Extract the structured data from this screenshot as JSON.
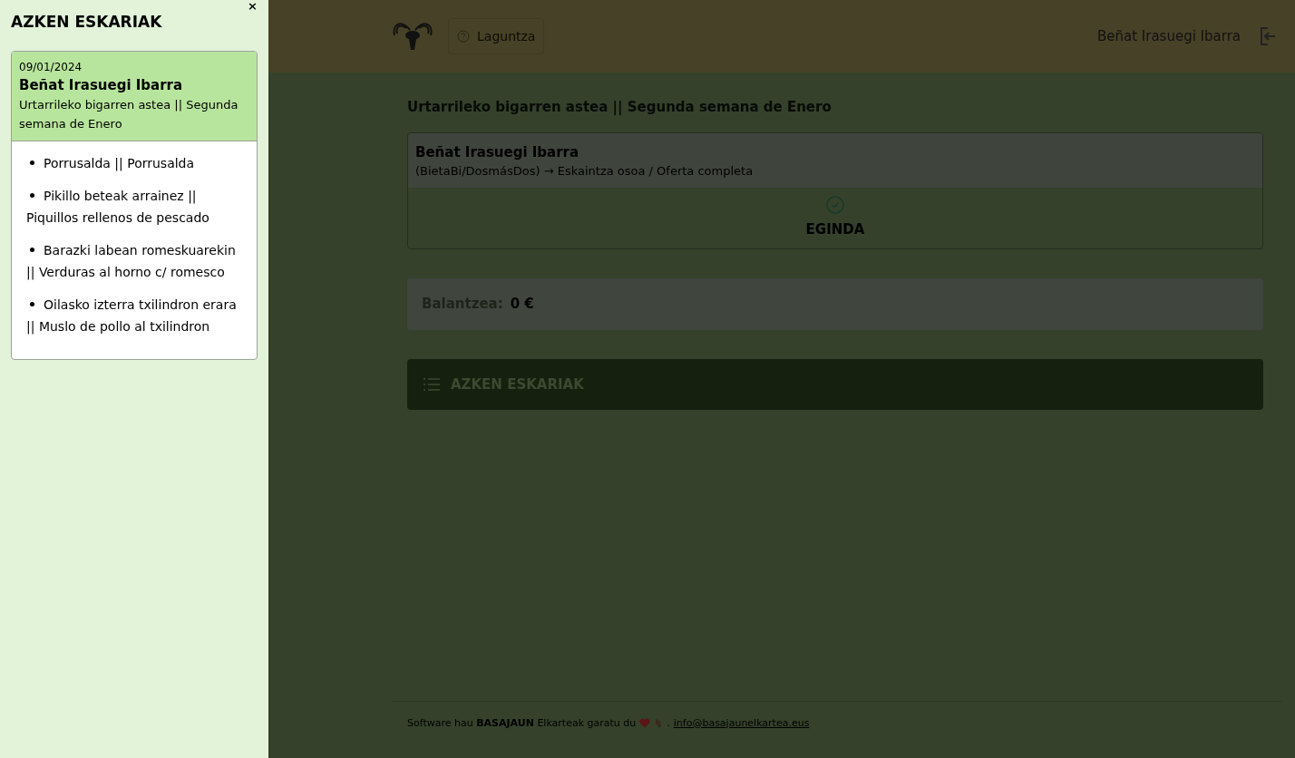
{
  "drawer": {
    "title": "AZKEN ESKARIAK",
    "close": "×",
    "orders": [
      {
        "date": "09/01/2024",
        "name": "Beñat Irasuegi Ibarra",
        "week": "Urtarrileko bigarren astea || Segunda semana de Enero",
        "items": [
          "Porrusalda || Porrusalda",
          "Pikillo beteak arrainez || Piquillos rellenos de pescado",
          "Barazki labean romeskuarekin || Verduras al horno c/ romesco",
          "Oilasko izterra txilindron erara || Muslo de pollo al txilindron"
        ]
      }
    ]
  },
  "header": {
    "help": "Laguntza",
    "user": "Beñat Irasuegi Ibarra"
  },
  "main": {
    "week_title": "Urtarrileko bigarren astea || Segunda semana de Enero",
    "order": {
      "name": "Beñat Irasuegi Ibarra",
      "offer": "(BietaBi/DosmásDos) → Eskaintza osoa / Oferta completa",
      "done": true,
      "status": "EGINDA"
    },
    "balance": {
      "label": "Balantzea:",
      "value": "0 €"
    },
    "orders_button": "AZKEN ESKARIAK"
  },
  "footer": {
    "text": "Software hau **BASAJAUN** Elkarteak garatu du",
    "separator": ".",
    "email": "info@basajaunelkartea.eus"
  }
}
